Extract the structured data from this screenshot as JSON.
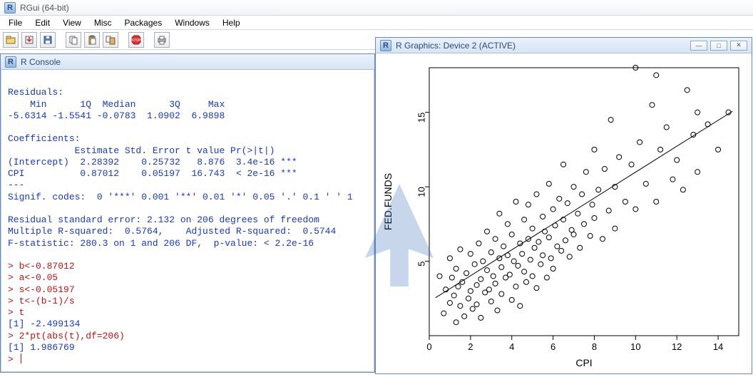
{
  "app": {
    "title": "RGui (64-bit)"
  },
  "menu": [
    "File",
    "Edit",
    "View",
    "Misc",
    "Packages",
    "Windows",
    "Help"
  ],
  "toolbar_icons": [
    "open",
    "load-ws",
    "save",
    "copy",
    "paste",
    "copy-paste",
    "stop",
    "print"
  ],
  "console": {
    "title": "R Console",
    "output_lines": [
      "",
      "Residuals:",
      "    Min      1Q  Median      3Q     Max ",
      "-5.6314 -1.5541 -0.0783  1.0902  6.9898 ",
      "",
      "Coefficients:",
      "            Estimate Std. Error t value Pr(>|t|)    ",
      "(Intercept)  2.28392    0.25732   8.876  3.4e-16 ***",
      "CPI          0.87012    0.05197  16.743  < 2e-16 ***",
      "---",
      "Signif. codes:  0 '***' 0.001 '**' 0.01 '*' 0.05 '.' 0.1 ' ' 1",
      "",
      "Residual standard error: 2.132 on 206 degrees of freedom",
      "Multiple R-squared:  0.5764,\tAdjusted R-squared:  0.5744 ",
      "F-statistic: 280.3 on 1 and 206 DF,  p-value: < 2.2e-16",
      ""
    ],
    "input_blocks": [
      {
        "prompt": "> ",
        "text": "b<-0.87012"
      },
      {
        "prompt": "> ",
        "text": "a<-0.05"
      },
      {
        "prompt": "> ",
        "text": "s<-0.05197"
      },
      {
        "prompt": "> ",
        "text": "t<-(b-1)/s"
      },
      {
        "prompt": "> ",
        "text": "t"
      }
    ],
    "echo1": "[1] -2.499134",
    "input_blocks2": [
      {
        "prompt": "> ",
        "text": "2*pt(abs(t),df=206)"
      }
    ],
    "echo2": "[1] 1.986769",
    "final_prompt": "> "
  },
  "graphics": {
    "title": "R Graphics: Device 2 (ACTIVE)"
  },
  "chart_data": {
    "type": "scatter",
    "title": "",
    "xlabel": "CPI",
    "ylabel": "FED.FUNDS",
    "xlim": [
      0,
      15
    ],
    "ylim": [
      0,
      18
    ],
    "x_ticks": [
      0,
      2,
      4,
      6,
      8,
      10,
      12,
      14
    ],
    "y_ticks": [
      5,
      10,
      15
    ],
    "fit_line": {
      "intercept": 2.28392,
      "slope": 0.87012
    },
    "points": [
      [
        0.5,
        4.0
      ],
      [
        0.7,
        1.5
      ],
      [
        0.8,
        3.1
      ],
      [
        1.0,
        2.2
      ],
      [
        1.0,
        5.2
      ],
      [
        1.1,
        3.9
      ],
      [
        1.2,
        2.7
      ],
      [
        1.3,
        4.5
      ],
      [
        1.3,
        0.9
      ],
      [
        1.4,
        3.3
      ],
      [
        1.5,
        2.0
      ],
      [
        1.5,
        5.8
      ],
      [
        1.6,
        3.6
      ],
      [
        1.7,
        1.3
      ],
      [
        1.8,
        4.2
      ],
      [
        1.9,
        2.5
      ],
      [
        2.0,
        3.0
      ],
      [
        2.0,
        5.5
      ],
      [
        2.1,
        1.8
      ],
      [
        2.2,
        4.8
      ],
      [
        2.3,
        3.4
      ],
      [
        2.3,
        2.1
      ],
      [
        2.4,
        6.2
      ],
      [
        2.5,
        3.8
      ],
      [
        2.5,
        1.2
      ],
      [
        2.6,
        5.0
      ],
      [
        2.7,
        2.9
      ],
      [
        2.8,
        4.4
      ],
      [
        2.8,
        7.0
      ],
      [
        2.9,
        3.1
      ],
      [
        3.0,
        5.6
      ],
      [
        3.0,
        2.3
      ],
      [
        3.1,
        4.0
      ],
      [
        3.2,
        6.5
      ],
      [
        3.2,
        3.5
      ],
      [
        3.3,
        1.7
      ],
      [
        3.4,
        5.2
      ],
      [
        3.4,
        8.2
      ],
      [
        3.5,
        4.6
      ],
      [
        3.5,
        2.8
      ],
      [
        3.6,
        6.0
      ],
      [
        3.7,
        3.9
      ],
      [
        3.8,
        5.4
      ],
      [
        3.8,
        7.5
      ],
      [
        3.9,
        4.1
      ],
      [
        4.0,
        2.4
      ],
      [
        4.0,
        6.8
      ],
      [
        4.1,
        5.0
      ],
      [
        4.2,
        3.3
      ],
      [
        4.2,
        9.0
      ],
      [
        4.3,
        4.7
      ],
      [
        4.4,
        6.2
      ],
      [
        4.4,
        2.0
      ],
      [
        4.5,
        5.5
      ],
      [
        4.6,
        7.8
      ],
      [
        4.6,
        4.3
      ],
      [
        4.7,
        3.6
      ],
      [
        4.8,
        6.5
      ],
      [
        4.8,
        8.8
      ],
      [
        4.9,
        5.1
      ],
      [
        5.0,
        4.0
      ],
      [
        5.0,
        7.2
      ],
      [
        5.1,
        5.9
      ],
      [
        5.2,
        3.2
      ],
      [
        5.2,
        9.5
      ],
      [
        5.3,
        6.3
      ],
      [
        5.4,
        4.8
      ],
      [
        5.5,
        8.0
      ],
      [
        5.5,
        5.4
      ],
      [
        5.6,
        7.0
      ],
      [
        5.7,
        3.9
      ],
      [
        5.8,
        6.6
      ],
      [
        5.8,
        10.2
      ],
      [
        5.9,
        5.2
      ],
      [
        6.0,
        8.5
      ],
      [
        6.0,
        4.5
      ],
      [
        6.1,
        7.4
      ],
      [
        6.2,
        6.0
      ],
      [
        6.3,
        9.2
      ],
      [
        6.4,
        5.7
      ],
      [
        6.5,
        7.8
      ],
      [
        6.5,
        11.5
      ],
      [
        6.6,
        6.4
      ],
      [
        6.7,
        8.9
      ],
      [
        6.8,
        5.3
      ],
      [
        6.9,
        7.1
      ],
      [
        7.0,
        10.0
      ],
      [
        7.0,
        6.8
      ],
      [
        7.2,
        8.2
      ],
      [
        7.3,
        5.9
      ],
      [
        7.4,
        9.5
      ],
      [
        7.5,
        7.5
      ],
      [
        7.6,
        11.0
      ],
      [
        7.8,
        6.7
      ],
      [
        7.9,
        8.8
      ],
      [
        8.0,
        12.5
      ],
      [
        8.0,
        7.9
      ],
      [
        8.2,
        9.8
      ],
      [
        8.4,
        6.5
      ],
      [
        8.5,
        11.2
      ],
      [
        8.7,
        8.4
      ],
      [
        8.8,
        14.5
      ],
      [
        9.0,
        10.0
      ],
      [
        9.0,
        7.2
      ],
      [
        9.2,
        12.0
      ],
      [
        9.5,
        9.0
      ],
      [
        9.8,
        11.5
      ],
      [
        10.0,
        18.0
      ],
      [
        10.0,
        8.5
      ],
      [
        10.2,
        13.0
      ],
      [
        10.5,
        10.2
      ],
      [
        10.8,
        15.5
      ],
      [
        11.0,
        9.0
      ],
      [
        11.0,
        17.5
      ],
      [
        11.2,
        12.5
      ],
      [
        11.5,
        14.0
      ],
      [
        11.8,
        10.5
      ],
      [
        12.0,
        11.8
      ],
      [
        12.3,
        9.8
      ],
      [
        12.5,
        16.5
      ],
      [
        12.8,
        13.5
      ],
      [
        13.0,
        15.0
      ],
      [
        13.0,
        11.0
      ],
      [
        13.5,
        14.2
      ],
      [
        14.0,
        12.5
      ],
      [
        14.5,
        15.0
      ]
    ]
  }
}
